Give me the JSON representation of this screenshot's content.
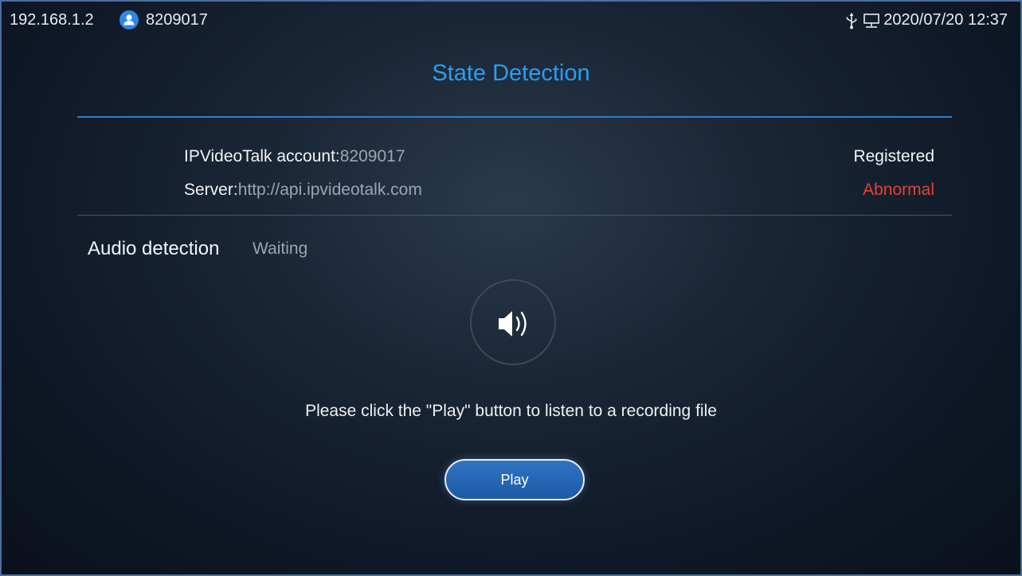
{
  "status_bar": {
    "ip": "192.168.1.2",
    "account_number": "8209017",
    "datetime": "2020/07/20 12:37",
    "icons": [
      "account-icon",
      "usb-icon",
      "network-icon"
    ]
  },
  "page": {
    "title": "State Detection"
  },
  "account_info": {
    "account_label": "IPVideoTalk account",
    "account_separator": ":",
    "account_value": "8209017",
    "account_state": "Registered",
    "server_label": "Server",
    "server_separator": ":",
    "server_value": "http://api.ipvideotalk.com",
    "server_state": "Abnormal"
  },
  "audio": {
    "label": "Audio detection",
    "status": "Waiting",
    "icon": "speaker-icon",
    "hint": "Please click the \"Play\" button to listen to a recording file",
    "play_label": "Play"
  },
  "colors": {
    "accent": "#2d9cf0",
    "abnormal": "#e04336",
    "button": "#2f74c4"
  }
}
